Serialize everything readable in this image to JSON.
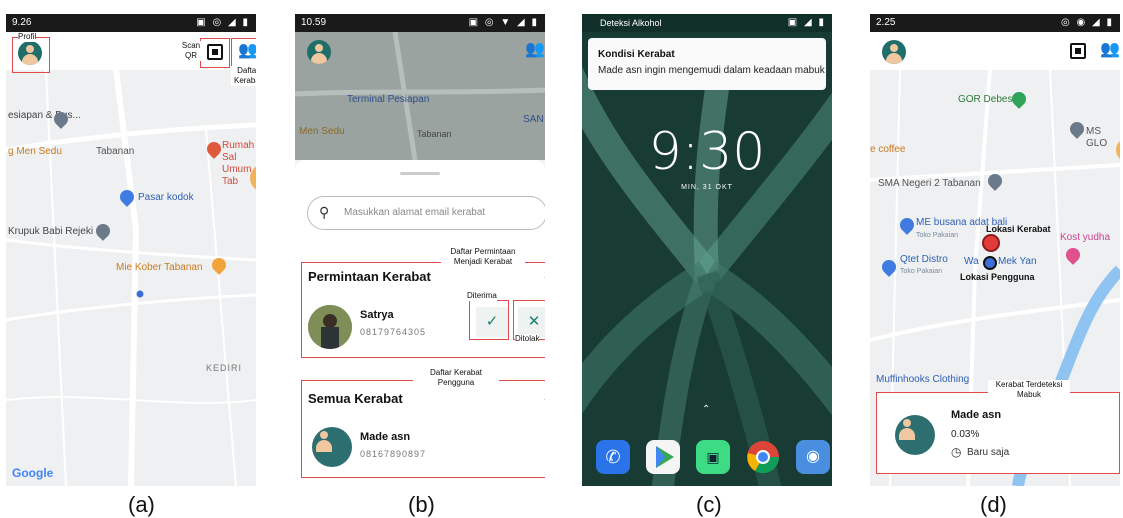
{
  "panels": {
    "a": {
      "caption": "(a)",
      "status_time": "9.26",
      "annotations": {
        "profile": "Profil",
        "scan_qr": "Scan QR",
        "contacts": "Daftar Kerabat"
      },
      "map_labels": [
        "esiapan & Bus...",
        "g Men Sedu",
        "Tabanan",
        "Rumah Sal Umum Tab",
        "Pasar kodok",
        "Krupuk Babi Rejeki",
        "Mie Kober Tabanan",
        "KEDIRI"
      ],
      "google": "Google"
    },
    "b": {
      "caption": "(b)",
      "status_time": "10.59",
      "map_labels": [
        "Terminal Pesiapan",
        "Men Sedu",
        "Tabanan",
        "SAN"
      ],
      "search_placeholder": "Masukkan alamat email kerabat",
      "annotations": {
        "request_list": "Daftar Permintaan Menjadi Kerabat",
        "accepted": "Diterima",
        "rejected": "Ditolak",
        "user_contacts": "Daftar Kerabat Pengguna"
      },
      "requests": {
        "title": "Permintaan Kerabat",
        "count": "1",
        "name": "Satrya",
        "phone": "08179764305"
      },
      "all_contacts": {
        "title": "Semua Kerabat",
        "count": "1",
        "name": "Made asn",
        "phone": "08167890897"
      }
    },
    "c": {
      "caption": "(c)",
      "status_app": "Deteksi Alkohol",
      "notification_title": "Kondisi Kerabat",
      "notification_body": "Made asn ingin mengemudi dalam keadaan mabuk",
      "clock": "9:30",
      "date": "MIN, 31 OKT"
    },
    "d": {
      "caption": "(d)",
      "status_time": "2.25",
      "map_labels": [
        "GOR Debes",
        "MS GLO",
        "e coffee",
        "SMA Negeri 2 Tabanan",
        "ME busana adat bali",
        "Toko Pakaian",
        "Qtet Distro",
        "Toko Pakaian",
        "Wa",
        "Mek Yan",
        "Kost yudha",
        "Muffinhooks Clothing"
      ],
      "annotations": {
        "contact_location": "Lokasi Kerabat",
        "user_location": "Lokasi Pengguna",
        "drunk_detected": "Kerabat Terdeteksi Mabuk"
      },
      "card": {
        "name": "Made asn",
        "level": "0.03%",
        "time": "Baru saja"
      }
    }
  }
}
